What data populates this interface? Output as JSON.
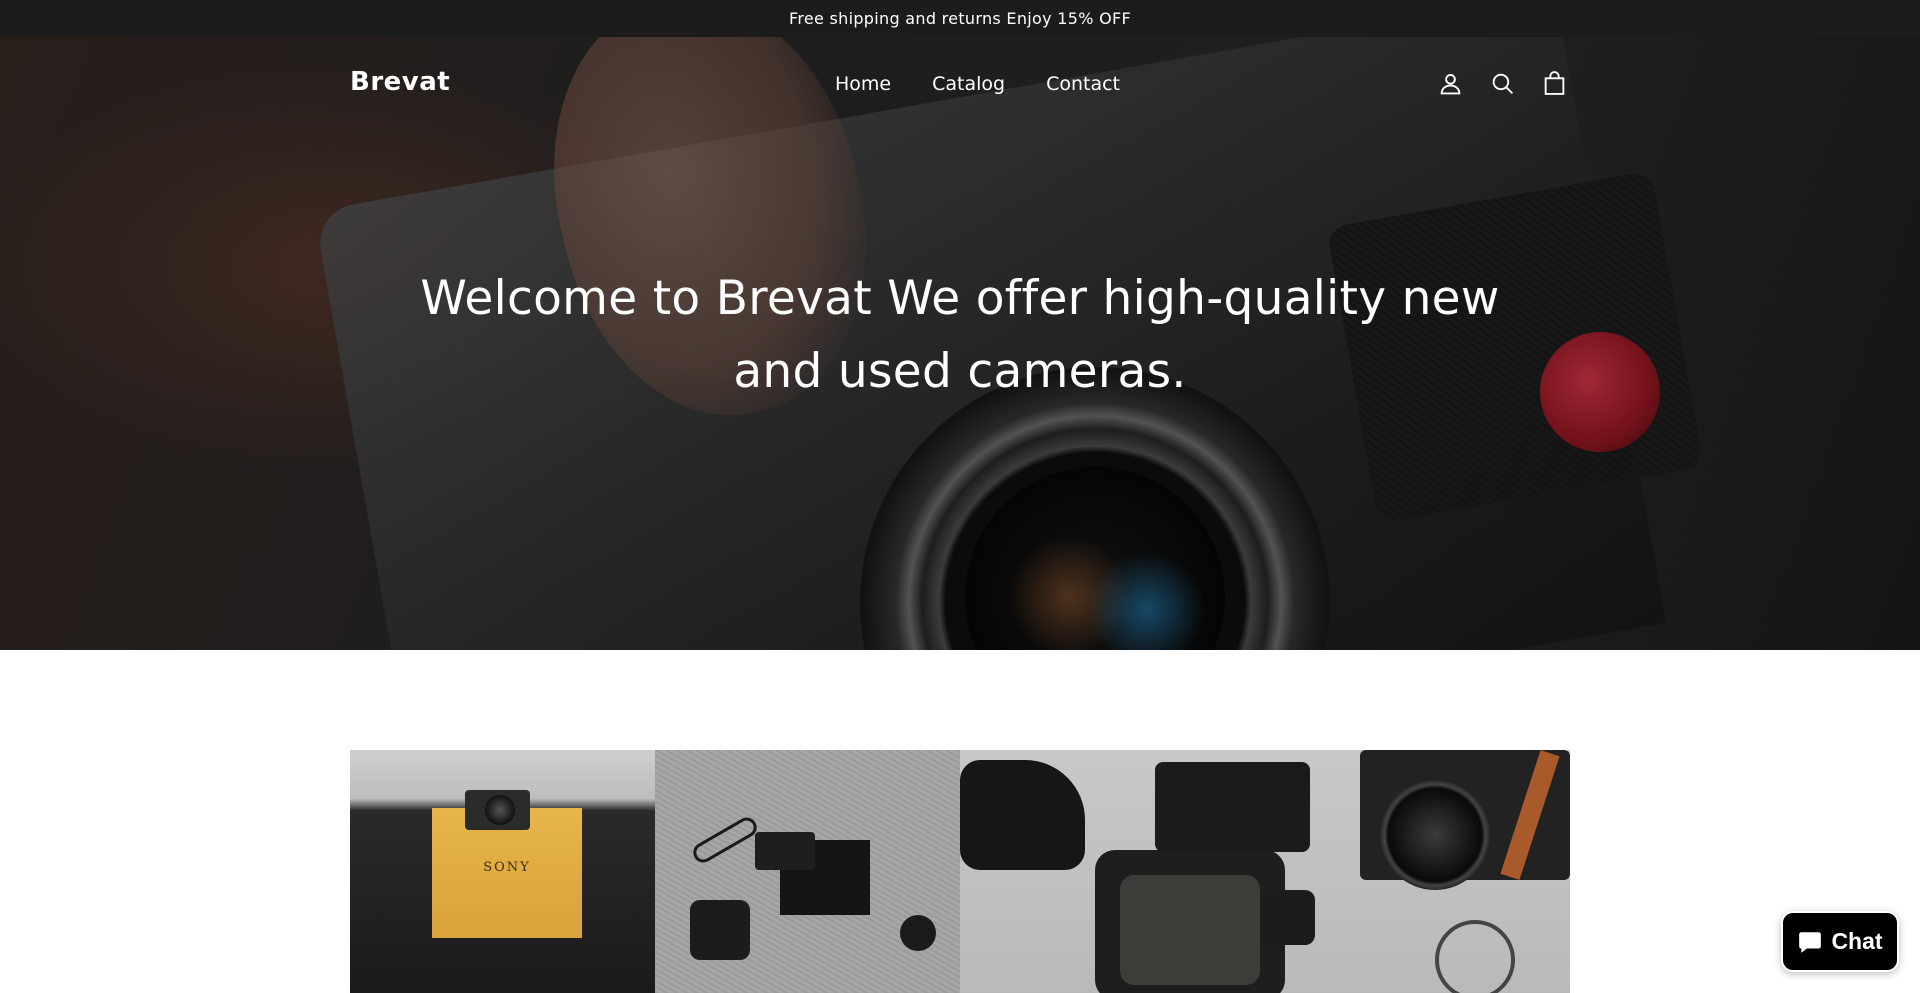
{
  "announcement": {
    "text": "Free shipping and returns Enjoy 15% OFF"
  },
  "header": {
    "logo": "Brevat",
    "nav": [
      {
        "label": "Home"
      },
      {
        "label": "Catalog"
      },
      {
        "label": "Contact"
      }
    ],
    "icons": [
      "account-icon",
      "search-icon",
      "cart-icon"
    ]
  },
  "hero": {
    "title": "Welcome to Brevat We offer high-quality new and used cameras."
  },
  "collage": {
    "tile_1": {
      "box_label": "SONY"
    }
  },
  "chat": {
    "label": "Chat"
  },
  "colors": {
    "announcement_bg": "#1c1c1c",
    "chat_bg": "#000000",
    "text_on_dark": "#ffffff"
  }
}
